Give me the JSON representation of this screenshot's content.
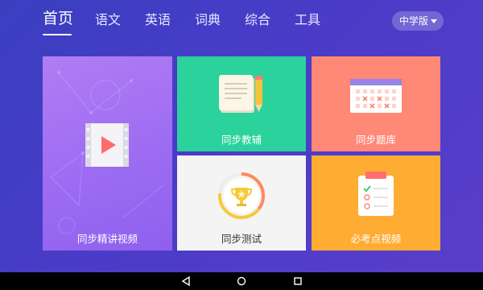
{
  "nav": {
    "tabs": [
      {
        "label": "首页",
        "active": true
      },
      {
        "label": "语文",
        "active": false
      },
      {
        "label": "英语",
        "active": false
      },
      {
        "label": "词典",
        "active": false
      },
      {
        "label": "综合",
        "active": false
      },
      {
        "label": "工具",
        "active": false
      }
    ],
    "edition_label": "中学版"
  },
  "cards": {
    "video": {
      "label": "同步精讲视频",
      "color": "#9d6cf2"
    },
    "tutor": {
      "label": "同步教辅",
      "color": "#2bd29b"
    },
    "bank": {
      "label": "同步题库",
      "color": "#ff8877"
    },
    "test": {
      "label": "同步测试",
      "color": "#f4f4f4"
    },
    "exam": {
      "label": "必考点视频",
      "color": "#ffac33"
    }
  },
  "system_bar": {
    "icons": [
      "back-icon",
      "home-icon",
      "recents-icon"
    ]
  }
}
